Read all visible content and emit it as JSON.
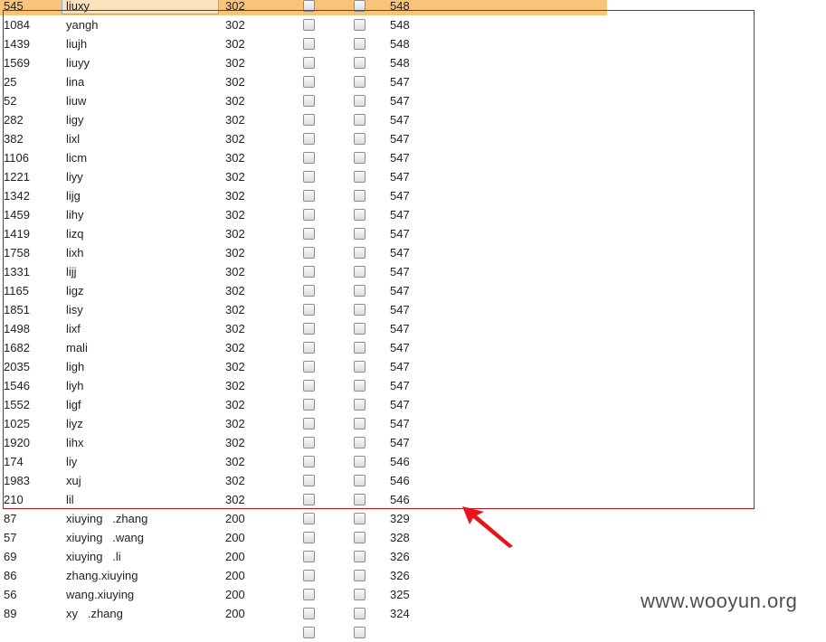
{
  "rows": [
    {
      "id": "545",
      "name": "liuxy",
      "code": "302",
      "length": "548",
      "selected": true
    },
    {
      "id": "1084",
      "name": "yangh",
      "code": "302",
      "length": "548"
    },
    {
      "id": "1439",
      "name": "liujh",
      "code": "302",
      "length": "548"
    },
    {
      "id": "1569",
      "name": "liuyy",
      "code": "302",
      "length": "548"
    },
    {
      "id": "25",
      "name": "lina",
      "code": "302",
      "length": "547"
    },
    {
      "id": "52",
      "name": "liuw",
      "code": "302",
      "length": "547"
    },
    {
      "id": "282",
      "name": "ligy",
      "code": "302",
      "length": "547"
    },
    {
      "id": "382",
      "name": "lixl",
      "code": "302",
      "length": "547"
    },
    {
      "id": "1106",
      "name": "licm",
      "code": "302",
      "length": "547"
    },
    {
      "id": "1221",
      "name": "liyy",
      "code": "302",
      "length": "547"
    },
    {
      "id": "1342",
      "name": "lijg",
      "code": "302",
      "length": "547"
    },
    {
      "id": "1459",
      "name": "lihy",
      "code": "302",
      "length": "547"
    },
    {
      "id": "1419",
      "name": "lizq",
      "code": "302",
      "length": "547"
    },
    {
      "id": "1758",
      "name": "lixh",
      "code": "302",
      "length": "547"
    },
    {
      "id": "1331",
      "name": "lijj",
      "code": "302",
      "length": "547"
    },
    {
      "id": "1165",
      "name": "ligz",
      "code": "302",
      "length": "547"
    },
    {
      "id": "1851",
      "name": "lisy",
      "code": "302",
      "length": "547"
    },
    {
      "id": "1498",
      "name": "lixf",
      "code": "302",
      "length": "547"
    },
    {
      "id": "1682",
      "name": "mali",
      "code": "302",
      "length": "547"
    },
    {
      "id": "2035",
      "name": "ligh",
      "code": "302",
      "length": "547"
    },
    {
      "id": "1546",
      "name": "liyh",
      "code": "302",
      "length": "547"
    },
    {
      "id": "1552",
      "name": "ligf",
      "code": "302",
      "length": "547"
    },
    {
      "id": "1025",
      "name": "liyz",
      "code": "302",
      "length": "547"
    },
    {
      "id": "1920",
      "name": "lihx",
      "code": "302",
      "length": "547"
    },
    {
      "id": "174",
      "name": "liy",
      "code": "302",
      "length": "546"
    },
    {
      "id": "1983",
      "name": "xuj",
      "code": "302",
      "length": "546"
    },
    {
      "id": "210",
      "name": "lil",
      "code": "302",
      "length": "546"
    },
    {
      "id": "87",
      "name": "xiuying   .zhang",
      "code": "200",
      "length": "329"
    },
    {
      "id": "57",
      "name": "xiuying   .wang",
      "code": "200",
      "length": "328"
    },
    {
      "id": "69",
      "name": "xiuying   .li",
      "code": "200",
      "length": "326"
    },
    {
      "id": "86",
      "name": "zhang.xiuying",
      "code": "200",
      "length": "326"
    },
    {
      "id": "56",
      "name": "wang.xiuying",
      "code": "200",
      "length": "325"
    },
    {
      "id": "89",
      "name": "xy   .zhang",
      "code": "200",
      "length": "324"
    },
    {
      "id": "",
      "name": "",
      "code": "",
      "length": ""
    }
  ],
  "colors": {
    "selected_row": "#f8c37b",
    "highlight_border": "#c9101c",
    "arrow": "#e8141c"
  },
  "watermark": "www.wooyun.org"
}
